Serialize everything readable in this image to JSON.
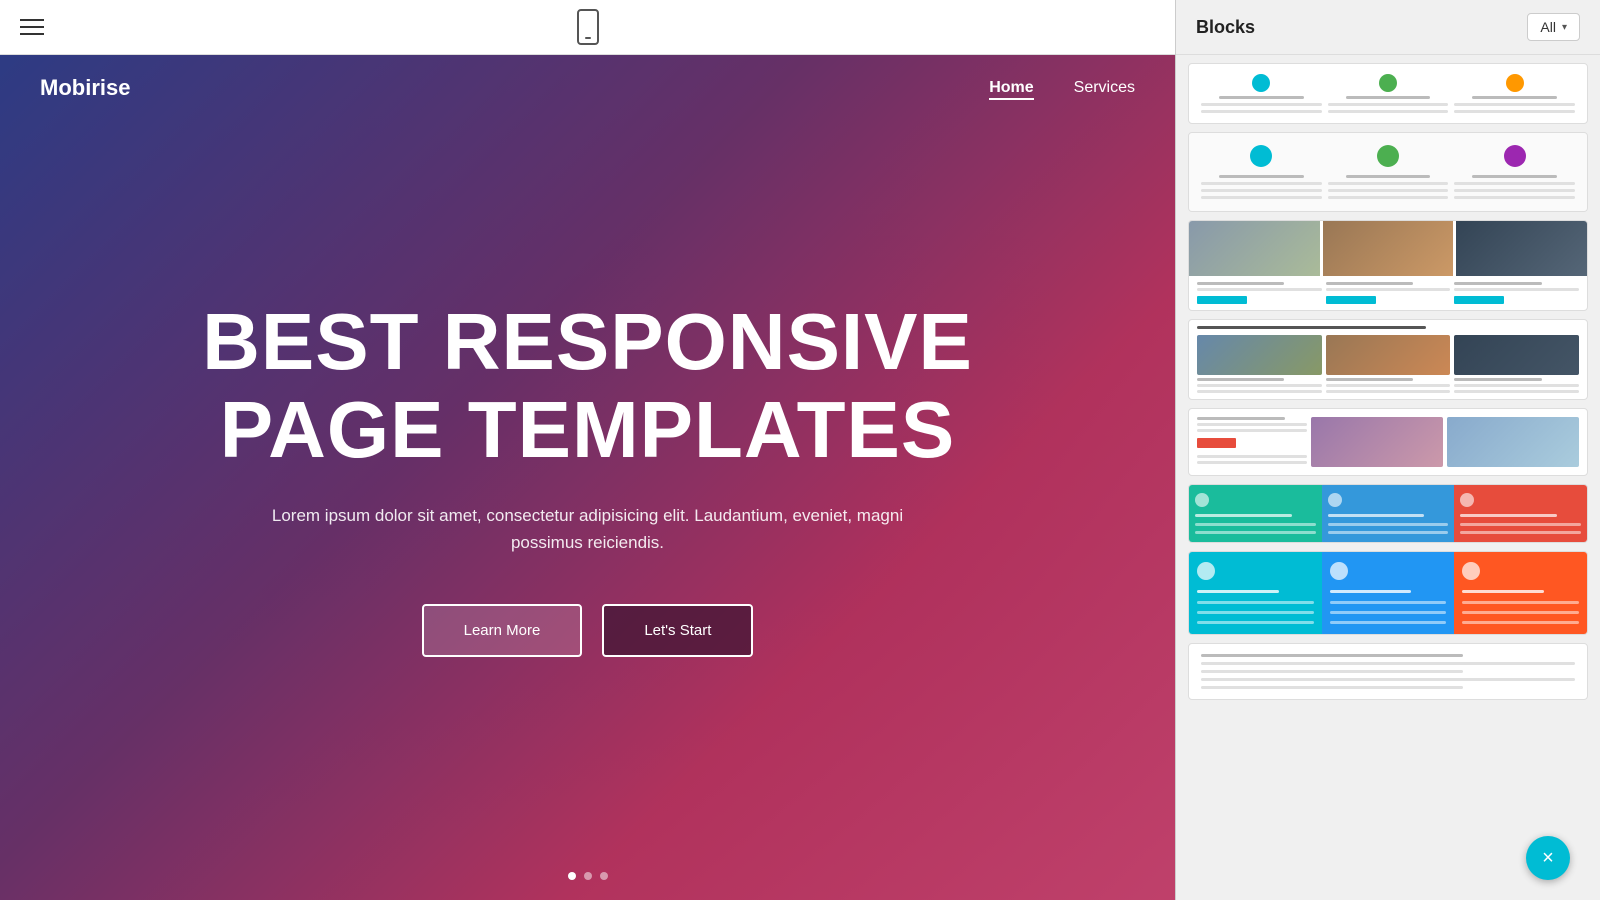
{
  "toolbar": {
    "hamburger_label": "menu",
    "device_label": "mobile preview"
  },
  "hero": {
    "logo": "Mobirise",
    "nav": [
      {
        "label": "Home",
        "active": true
      },
      {
        "label": "Services",
        "active": false
      }
    ],
    "title_line1": "BEST RESPONSIVE",
    "title_line2": "PAGE TEMPLATES",
    "subtitle": "Lorem ipsum dolor sit amet, consectetur adipisicing elit. Laudantium, eveniet, magni possimus reiciendis.",
    "btn_learn_more": "Learn More",
    "btn_lets_start": "Let's Start"
  },
  "blocks_panel": {
    "title": "Blocks",
    "filter_label": "All",
    "close_label": "×"
  }
}
